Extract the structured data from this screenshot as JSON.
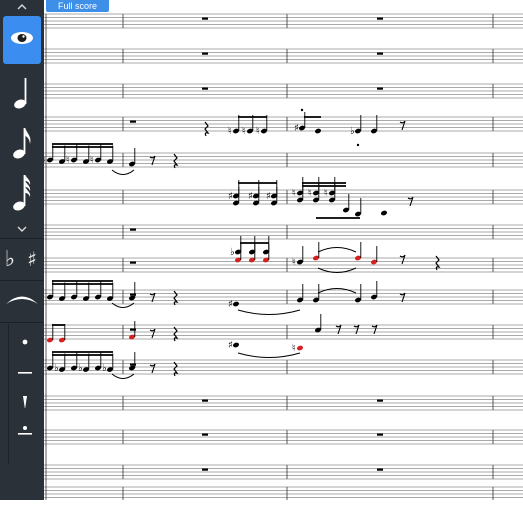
{
  "score": {
    "tab_label": "Full score"
  },
  "palette": {
    "scroll_up": "^",
    "scroll_down": "v",
    "tools": [
      {
        "name": "view-eye-icon",
        "state": "active"
      },
      {
        "name": "quarter-note-icon"
      },
      {
        "name": "eighth-note-icon"
      },
      {
        "name": "thirty-second-note-icon"
      },
      {
        "name": "flat-icon",
        "glyph": "♭"
      },
      {
        "name": "sharp-icon",
        "glyph": "♯"
      },
      {
        "name": "slur-icon"
      },
      {
        "name": "staccato-icon"
      },
      {
        "name": "tenuto-icon"
      },
      {
        "name": "staccatissimo-icon"
      },
      {
        "name": "tenuto-staccato-icon"
      }
    ]
  },
  "colors": {
    "sidebar": "#2b3138",
    "active_tool": "#3b8ef0",
    "tab": "#3d8fe8",
    "selected_notes": "#d81e1e",
    "ink": "#000000"
  }
}
